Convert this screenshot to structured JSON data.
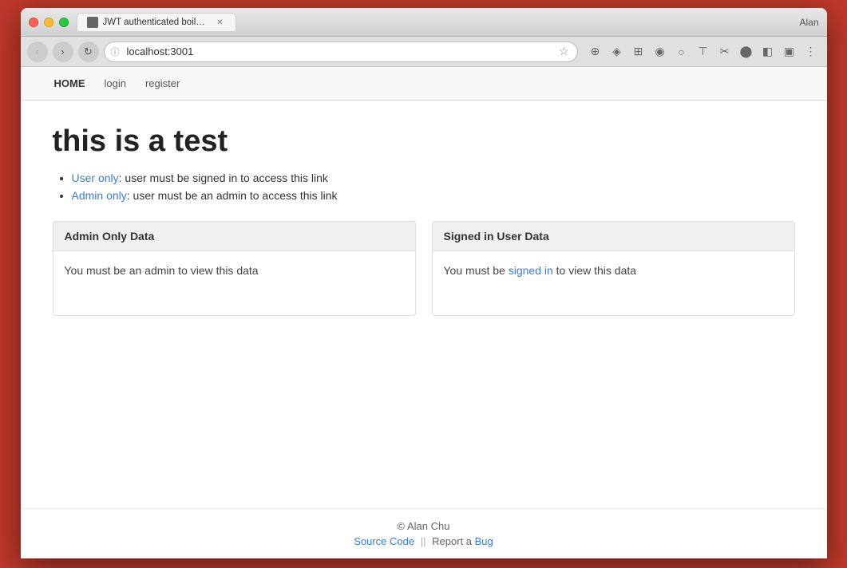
{
  "browser": {
    "tab_label": "JWT authenticated boilerplate",
    "url": "localhost:3001",
    "user": "Alan"
  },
  "navbar": {
    "home": "HOME",
    "login": "login",
    "register": "register"
  },
  "page": {
    "title": "this is a test",
    "list_items": [
      {
        "link_text": "User only",
        "rest": ": user must be signed in to access this link"
      },
      {
        "link_text": "Admin only",
        "rest": ": user must be an admin to access this link"
      }
    ],
    "admin_box": {
      "header": "Admin Only Data",
      "body": "You must be an admin to view this data"
    },
    "user_box": {
      "header": "Signed in User Data",
      "body_prefix": "You must be ",
      "body_link": "signed in",
      "body_suffix": " to view this data"
    }
  },
  "footer": {
    "copyright": "© Alan Chu",
    "source_code": "Source Code",
    "separator": "||",
    "report": "Report a",
    "bug": "Bug"
  }
}
